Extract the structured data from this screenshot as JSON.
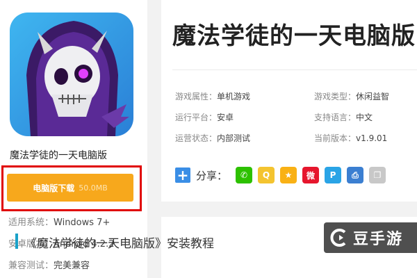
{
  "app": {
    "name": "魔法学徒的一天电脑版",
    "download_label": "电脑版下载",
    "download_size": "50.0MB",
    "info": [
      {
        "key": "适用系统：",
        "value": "Windows 7+"
      },
      {
        "key": "安卓版本：",
        "value": "Android 4.2.2"
      },
      {
        "key": "兼容测试：",
        "value": "完美兼容"
      }
    ]
  },
  "main": {
    "title": "魔法学徒的一天电脑版",
    "attributes": [
      {
        "key": "游戏属性：",
        "value": "单机游戏"
      },
      {
        "key": "游戏类型：",
        "value": "休闲益智"
      },
      {
        "key": "运行平台：",
        "value": "安卓"
      },
      {
        "key": "支持语言：",
        "value": "中文"
      },
      {
        "key": "运营状态：",
        "value": "内部测试"
      },
      {
        "key": "当前版本：",
        "value": "v1.9.01"
      }
    ],
    "share_label": "分享：",
    "share_icons": [
      {
        "name": "wechat-icon",
        "color": "#2dc100",
        "glyph": "✆"
      },
      {
        "name": "qq-icon",
        "color": "#f4c430",
        "glyph": "Q"
      },
      {
        "name": "qzone-icon",
        "color": "#f9b115",
        "glyph": "★"
      },
      {
        "name": "weibo-icon",
        "color": "#e6162d",
        "glyph": "微"
      },
      {
        "name": "tencent-weibo-icon",
        "color": "#2aa4e6",
        "glyph": "P"
      },
      {
        "name": "print-icon",
        "color": "#3b7fd1",
        "glyph": "⎙"
      },
      {
        "name": "copy-icon",
        "color": "#c8c8c8",
        "glyph": "❐"
      }
    ]
  },
  "guide": {
    "title": "《魔法学徒的一天电脑版》安装教程"
  },
  "watermark": {
    "text": "豆手游"
  },
  "colors": {
    "download": "#f7a81c",
    "highlight_frame": "#e00000",
    "accent_bar": "#1aa1c8"
  }
}
